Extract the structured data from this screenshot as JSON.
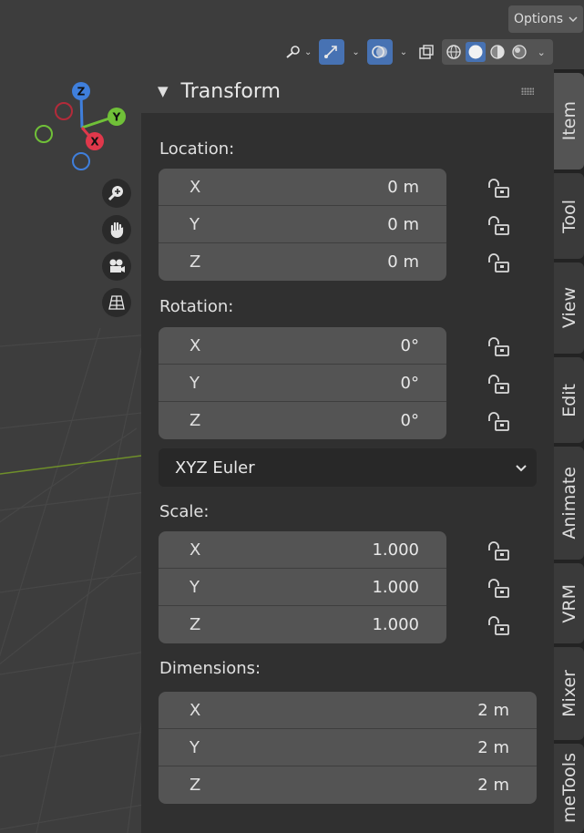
{
  "header": {
    "options_label": "Options",
    "tools": [
      {
        "icon": "pivot-icon"
      },
      {
        "icon": "transform-gizmo-icon"
      },
      {
        "icon": "overlays-icon"
      },
      {
        "icon": "xray-icon"
      }
    ],
    "shading_modes": [
      {
        "icon": "wireframe-shading-icon",
        "active": false
      },
      {
        "icon": "solid-shading-icon",
        "active": true
      },
      {
        "icon": "material-preview-icon",
        "active": false
      },
      {
        "icon": "rendered-shading-icon",
        "active": false
      }
    ]
  },
  "gizmo": {
    "axes": [
      {
        "label": "Z",
        "color": "#3f7fdc"
      },
      {
        "label": "Y",
        "color": "#70c038"
      },
      {
        "label": "X",
        "color": "#e0384b"
      }
    ]
  },
  "nav_buttons": [
    "zoom-icon",
    "pan-hand-icon",
    "camera-view-icon",
    "perspective-toggle-icon"
  ],
  "panel": {
    "title": "Transform",
    "location": {
      "label": "Location:",
      "rows": [
        {
          "axis": "X",
          "value": "0 m"
        },
        {
          "axis": "Y",
          "value": "0 m"
        },
        {
          "axis": "Z",
          "value": "0 m"
        }
      ]
    },
    "rotation": {
      "label": "Rotation:",
      "rows": [
        {
          "axis": "X",
          "value": "0°"
        },
        {
          "axis": "Y",
          "value": "0°"
        },
        {
          "axis": "Z",
          "value": "0°"
        }
      ],
      "mode": "XYZ Euler"
    },
    "scale": {
      "label": "Scale:",
      "rows": [
        {
          "axis": "X",
          "value": "1.000"
        },
        {
          "axis": "Y",
          "value": "1.000"
        },
        {
          "axis": "Z",
          "value": "1.000"
        }
      ]
    },
    "dimensions": {
      "label": "Dimensions:",
      "rows": [
        {
          "axis": "X",
          "value": "2 m"
        },
        {
          "axis": "Y",
          "value": "2 m"
        },
        {
          "axis": "Z",
          "value": "2 m"
        }
      ]
    }
  },
  "tabs": [
    {
      "label": "Item",
      "active": true
    },
    {
      "label": "Tool",
      "active": false
    },
    {
      "label": "View",
      "active": false
    },
    {
      "label": "Edit",
      "active": false
    },
    {
      "label": "Animate",
      "active": false
    },
    {
      "label": "VRM",
      "active": false
    },
    {
      "label": "Mixer",
      "active": false
    },
    {
      "label": "meTools",
      "active": false
    }
  ],
  "colors": {
    "accent": "#4772b3",
    "panel_bg": "#303030",
    "field_bg": "#545454",
    "viewport_bg": "#3d3d3d"
  }
}
